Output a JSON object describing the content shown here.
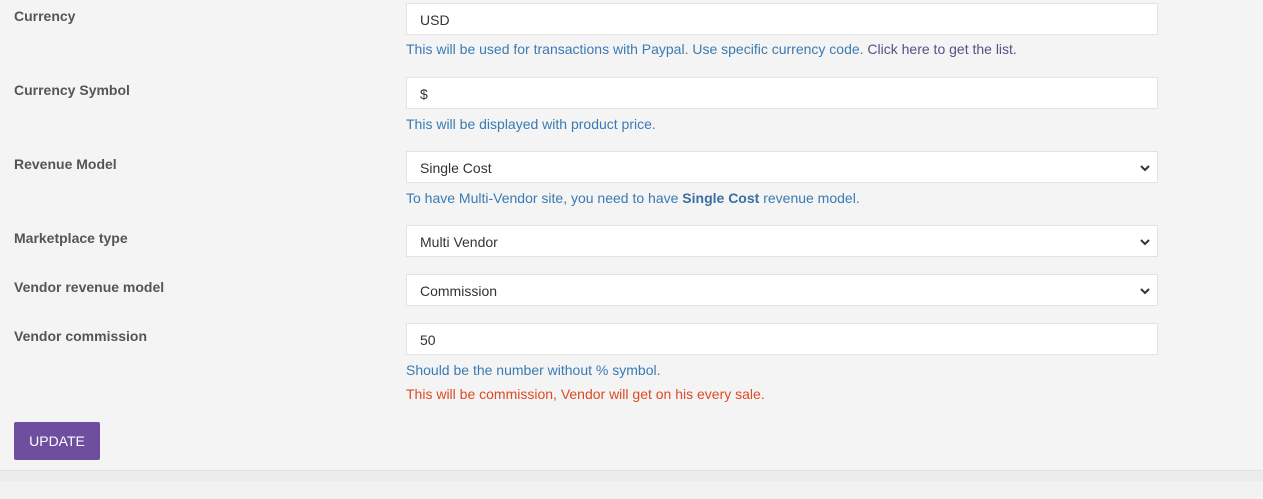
{
  "form": {
    "currency": {
      "label": "Currency",
      "value": "USD",
      "help_text": "This will be used for transactions with Paypal. Use specific currency code.",
      "help_link": "Click here to get the list."
    },
    "currency_symbol": {
      "label": "Currency Symbol",
      "value": "$",
      "help_text": "This will be displayed with product price."
    },
    "revenue_model": {
      "label": "Revenue Model",
      "value": "Single Cost",
      "help_prefix": "To have Multi-Vendor site, you need to have",
      "help_bold": "Single Cost",
      "help_suffix": "revenue model."
    },
    "marketplace_type": {
      "label": "Marketplace type",
      "value": "Multi Vendor"
    },
    "vendor_revenue_model": {
      "label": "Vendor revenue model",
      "value": "Commission"
    },
    "vendor_commission": {
      "label": "Vendor commission",
      "value": "50",
      "help_text": "Should be the number without % symbol.",
      "warning_text": "This will be commission, Vendor will get on his every sale."
    }
  },
  "actions": {
    "update_label": "UPDATE"
  },
  "colors": {
    "accent": "#6f4ea0",
    "help_text": "#3a7ab3",
    "warning": "#dd4a25"
  },
  "icons": {
    "select_arrow": "chevron-down-icon"
  }
}
